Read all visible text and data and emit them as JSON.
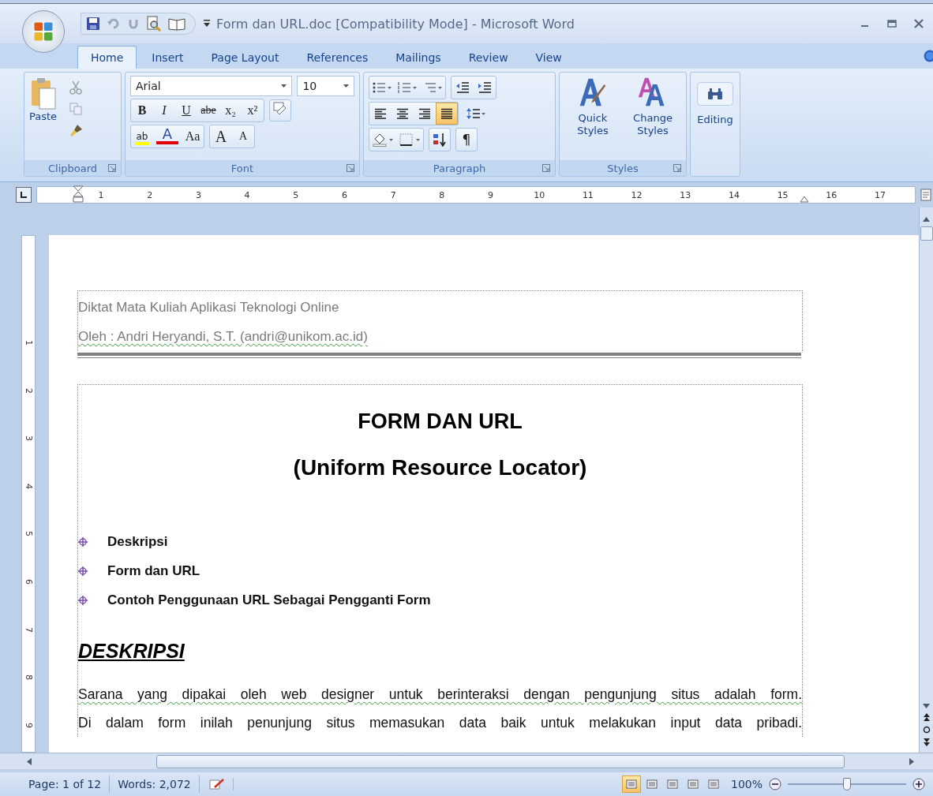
{
  "window": {
    "title": "Form dan URL.doc [Compatibility Mode] - Microsoft Word"
  },
  "tabs": [
    {
      "label": "Home",
      "selected": true
    },
    {
      "label": "Insert",
      "selected": false
    },
    {
      "label": "Page Layout",
      "selected": false
    },
    {
      "label": "References",
      "selected": false
    },
    {
      "label": "Mailings",
      "selected": false
    },
    {
      "label": "Review",
      "selected": false
    },
    {
      "label": "View",
      "selected": false
    }
  ],
  "ribbon": {
    "clipboard": {
      "label": "Clipboard",
      "paste": "Paste"
    },
    "font": {
      "label": "Font",
      "font_name": "Arial",
      "font_size": "10",
      "format_buttons": [
        "B",
        "I",
        "U",
        "abe",
        "x₂",
        "x²"
      ],
      "case_button": "Aa",
      "grow_button": "A",
      "shrink_button": "A",
      "color_button": "A",
      "highlight_button": "ab"
    },
    "paragraph": {
      "label": "Paragraph",
      "align_buttons": [
        {
          "selected": false
        },
        {
          "selected": false
        },
        {
          "selected": false
        },
        {
          "selected": true
        }
      ],
      "pilcrow": "¶"
    },
    "styles": {
      "label": "Styles",
      "buttons": [
        "Quick Styles",
        "Change Styles"
      ]
    },
    "editing": {
      "label": "Editing"
    }
  },
  "ruler": {
    "marks": [
      "1",
      "2",
      "3",
      "4",
      "5",
      "6",
      "7",
      "8",
      "9",
      "10",
      "11",
      "12",
      "13",
      "14",
      "15",
      "16",
      "17"
    ]
  },
  "vertical_ruler": {
    "marks": [
      "1",
      "2",
      "3",
      "4",
      "5",
      "6",
      "7",
      "8",
      "9"
    ]
  },
  "document": {
    "header": [
      {
        "text": "Diktat Mata Kuliah Aplikasi Teknologi Online",
        "flagged": false
      },
      {
        "text": "Oleh : Andri Heryandi, S.T.  (andri@unikom.ac.id)",
        "flagged": true
      }
    ],
    "title": "FORM DAN URL",
    "subtitle": "(Uniform Resource Locator)",
    "bullets": [
      "Deskripsi",
      "Form dan URL",
      "Contoh Penggunaan URL Sebagai Pengganti Form"
    ],
    "heading": "DESKRIPSI",
    "lines": [
      {
        "text": "Sarana yang dipakai oleh web designer untuk berinteraksi dengan pengunjung situs adalah form.",
        "flagged": true
      },
      {
        "text": "Di dalam form inilah penunjung situs memasukan data baik untuk melakukan input data pribadi.",
        "flagged": false
      }
    ]
  },
  "status_bar": {
    "page": "Page: 1 of 12",
    "words": "Words: 2,072",
    "views": [
      {
        "selected": true
      },
      {
        "selected": false
      },
      {
        "selected": false
      },
      {
        "selected": false
      },
      {
        "selected": false
      }
    ],
    "zoom": "100%",
    "zoom_slider": {
      "level": 0.5
    }
  }
}
